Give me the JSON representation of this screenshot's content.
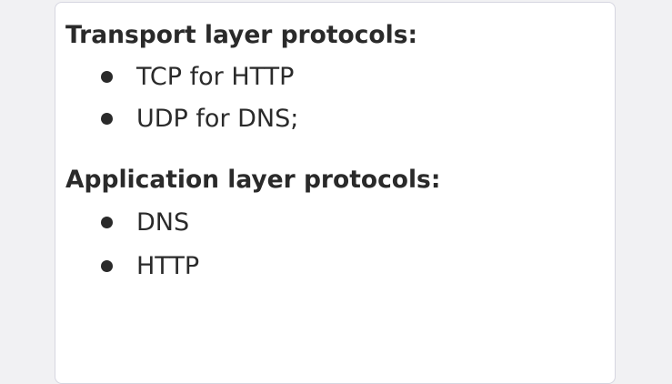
{
  "sections": [
    {
      "heading": "Transport layer protocols:",
      "items": [
        "TCP for HTTP",
        "UDP for DNS;"
      ]
    },
    {
      "heading": "Application layer protocols:",
      "items": [
        "DNS",
        "HTTP"
      ]
    }
  ]
}
